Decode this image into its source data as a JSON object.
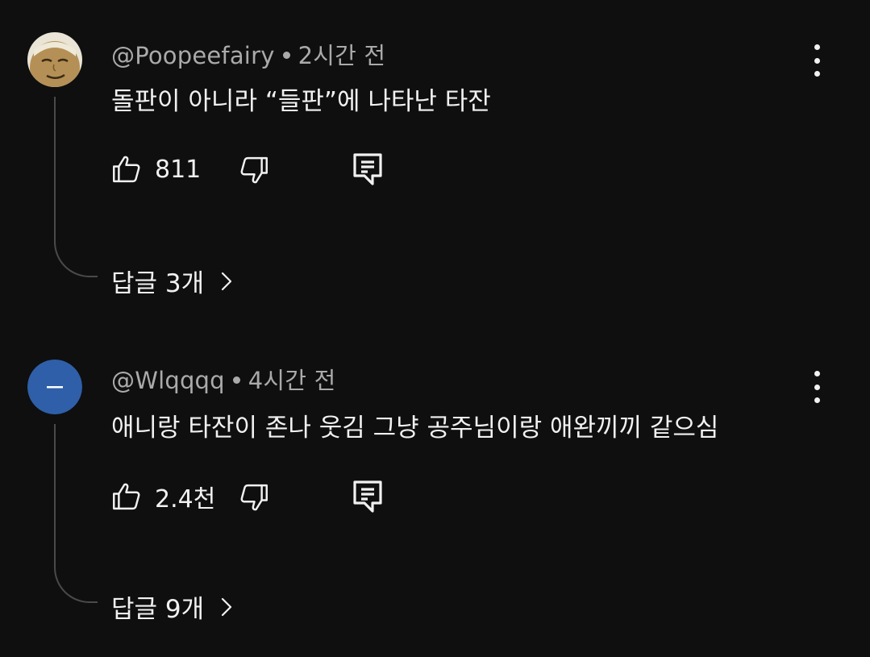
{
  "comments": [
    {
      "author": "@Poopeefairy",
      "time": "2시간 전",
      "text": "돌판이 아니라 “들판”에 나타난 타잔",
      "likes": "811",
      "replies_label": "답글 3개",
      "avatar_icon": "cartoon-face-avatar"
    },
    {
      "author": "@Wlqqqq",
      "time": "4시간 전",
      "text": "애니랑 타잔이 존나 웃김 그냥 공주님이랑 애완끼끼 같으심",
      "likes": "2.4천",
      "replies_label": "답글 9개",
      "avatar_icon": "default-blue-avatar",
      "avatar_color": "#2f5fa8"
    }
  ],
  "icons": {
    "like": "thumbs-up-icon",
    "dislike": "thumbs-down-icon",
    "reply": "reply-comment-icon",
    "more": "more-vertical-icon",
    "expand": "chevron-right-icon"
  },
  "colors": {
    "background": "#0f0f0f",
    "text": "#f1f1f1",
    "meta": "#aaaaaa"
  }
}
